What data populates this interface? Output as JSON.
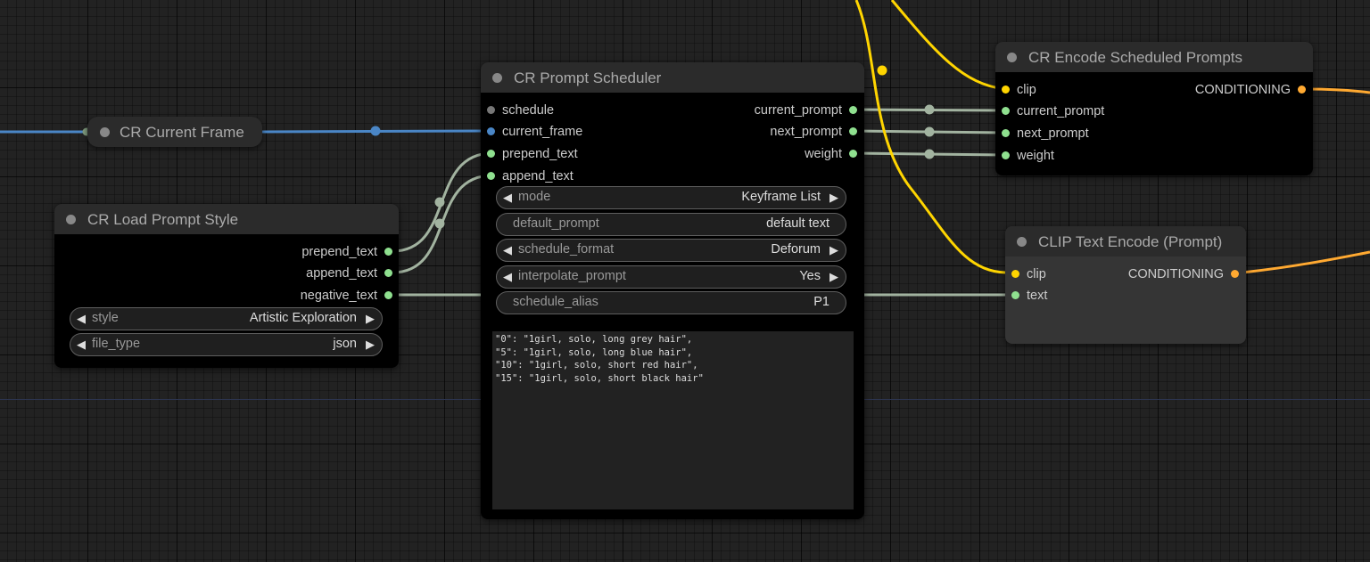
{
  "colors": {
    "string": "#8fe08f",
    "int": "#4a86c6",
    "clip": "#ffd500",
    "conditioning": "#ffa931",
    "link_string": "#a2b3a0"
  },
  "nodes": {
    "current_frame": {
      "title": "CR Current Frame"
    },
    "load_prompt_style": {
      "title": "CR Load Prompt Style",
      "outputs": [
        "prepend_text",
        "append_text",
        "negative_text"
      ],
      "widgets": [
        {
          "label": "style",
          "value": "Artistic Exploration"
        },
        {
          "label": "file_type",
          "value": "json"
        }
      ]
    },
    "prompt_scheduler": {
      "title": "CR Prompt Scheduler",
      "inputs": [
        "schedule",
        "current_frame",
        "prepend_text",
        "append_text"
      ],
      "outputs": [
        "current_prompt",
        "next_prompt",
        "weight"
      ],
      "widgets": [
        {
          "label": "mode",
          "value": "Keyframe List"
        },
        {
          "label": "default_prompt",
          "value": "default text"
        },
        {
          "label": "schedule_format",
          "value": "Deforum"
        },
        {
          "label": "interpolate_prompt",
          "value": "Yes"
        },
        {
          "label": "schedule_alias",
          "value": "P1"
        }
      ],
      "keyframe_text": "\"0\": \"1girl, solo, long grey hair\",\n\"5\": \"1girl, solo, long blue hair\",\n\"10\": \"1girl, solo, short red hair\",\n\"15\": \"1girl, solo, short black hair\""
    },
    "encode_scheduled": {
      "title": "CR Encode Scheduled Prompts",
      "inputs": [
        "clip",
        "current_prompt",
        "next_prompt",
        "weight"
      ],
      "outputs": [
        "CONDITIONING"
      ]
    },
    "clip_text_encode": {
      "title": "CLIP Text Encode (Prompt)",
      "inputs": [
        "clip",
        "text"
      ],
      "outputs": [
        "CONDITIONING"
      ]
    }
  }
}
